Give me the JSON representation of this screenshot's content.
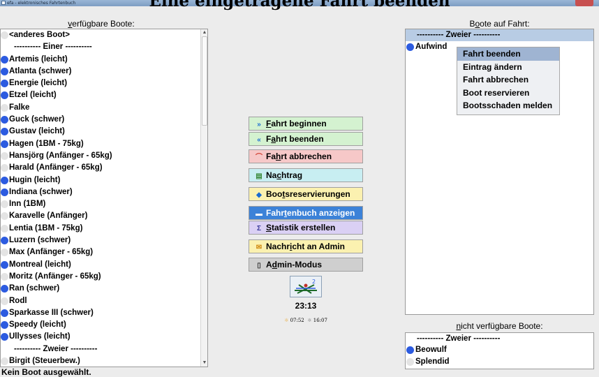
{
  "window": {
    "title": "efa - elektronisches Fahrtenbuch"
  },
  "overlay_heading": "Eine eingetragene Fahrt beenden",
  "left_panel": {
    "heading_underlined": "v",
    "heading_rest": "erfügbare Boote:",
    "items": [
      {
        "label": "<anderes Boot>",
        "dot": "grey"
      },
      {
        "label": "---------- Einer ----------",
        "dot": "none"
      },
      {
        "label": "Artemis (leicht)",
        "dot": "blue"
      },
      {
        "label": "Atlanta (schwer)",
        "dot": "blue"
      },
      {
        "label": "Energie (leicht)",
        "dot": "blue"
      },
      {
        "label": "Etzel (leicht)",
        "dot": "blue"
      },
      {
        "label": "Falke",
        "dot": "grey"
      },
      {
        "label": "Guck (schwer)",
        "dot": "blue"
      },
      {
        "label": "Gustav (leicht)",
        "dot": "blue"
      },
      {
        "label": "Hagen (1BM - 75kg)",
        "dot": "blue"
      },
      {
        "label": "Hansjörg (Anfänger - 65kg)",
        "dot": "grey"
      },
      {
        "label": "Harald (Anfänger - 65kg)",
        "dot": "grey"
      },
      {
        "label": "Hugin (leicht)",
        "dot": "blue"
      },
      {
        "label": "Indiana (schwer)",
        "dot": "blue"
      },
      {
        "label": "Inn (1BM)",
        "dot": "grey"
      },
      {
        "label": "Karavelle (Anfänger)",
        "dot": "grey"
      },
      {
        "label": "Lentia (1BM - 75kg)",
        "dot": "grey"
      },
      {
        "label": "Luzern (schwer)",
        "dot": "blue"
      },
      {
        "label": "Max (Anfänger - 65kg)",
        "dot": "grey"
      },
      {
        "label": "Montreal (leicht)",
        "dot": "blue"
      },
      {
        "label": "Moritz (Anfänger - 65kg)",
        "dot": "grey"
      },
      {
        "label": "Ran (schwer)",
        "dot": "blue"
      },
      {
        "label": "Rodl",
        "dot": "grey"
      },
      {
        "label": "Sparkasse III (schwer)",
        "dot": "blue"
      },
      {
        "label": "Speedy (leicht)",
        "dot": "blue"
      },
      {
        "label": "Ullysses (leicht)",
        "dot": "blue"
      },
      {
        "label": "---------- Zweier ----------",
        "dot": "none"
      },
      {
        "label": "Birgit (Steuerbew.)",
        "dot": "grey"
      }
    ]
  },
  "buttons": {
    "begin": {
      "icon": "»",
      "u": "F",
      "rest": "ahrt beginnen"
    },
    "end": {
      "icon": "«",
      "pre": "F",
      "u": "a",
      "rest": "hrt beenden"
    },
    "abort": {
      "icon": "⌒",
      "pre": "Fa",
      "u": "h",
      "rest": "rt abbrechen"
    },
    "nachtrag": {
      "icon": "▤",
      "pre": "Na",
      "u": "c",
      "rest": "htrag"
    },
    "reservations": {
      "icon": "◆",
      "pre": "Boo",
      "u": "t",
      "rest": "sreservierungen"
    },
    "logbook": {
      "icon": "▬",
      "pre": "Fahr",
      "u": "t",
      "rest": "enbuch anzeigen"
    },
    "statistics": {
      "icon": "Σ",
      "u": "S",
      "rest": "tatistik erstellen"
    },
    "message": {
      "icon": "✉",
      "pre": "Nachr",
      "u": "i",
      "rest": "cht an Admin"
    },
    "admin": {
      "icon": "▯",
      "pre": "A",
      "u": "d",
      "rest": "min-Modus"
    }
  },
  "clock": "23:13",
  "sun": {
    "sunrise": "07:52",
    "sunset": "16:07"
  },
  "right_panel": {
    "heading_pre": "B",
    "heading_u": "o",
    "heading_rest": "ote auf Fahrt:",
    "group": "---------- Zweier ----------",
    "items": [
      {
        "label": "Aufwind",
        "dot": "blue"
      }
    ]
  },
  "context_menu": [
    "Fahrt beenden",
    "Eintrag ändern",
    "Fahrt abbrechen",
    "Boot reservieren",
    "Bootsschaden melden"
  ],
  "unavailable_panel": {
    "heading_u": "n",
    "heading_rest": "icht verfügbare Boote:",
    "group": "---------- Zweier ----------",
    "items": [
      {
        "label": "Beowulf",
        "dot": "blue"
      },
      {
        "label": "Splendid",
        "dot": "grey"
      }
    ]
  },
  "status": "Kein Boot ausgewählt.",
  "colors": {
    "accent_blue": "#2c5be0",
    "logbook_button": "#3c82d8"
  }
}
